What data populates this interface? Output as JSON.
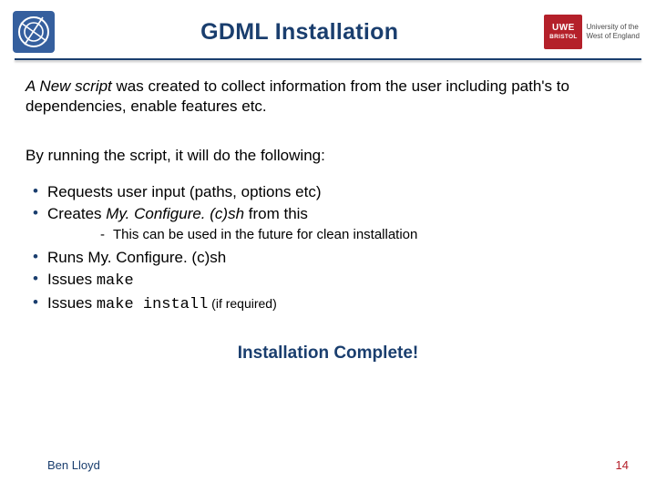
{
  "header": {
    "title": "GDML Installation",
    "cern_label": "CERN",
    "uwe": {
      "badge_top": "UWE",
      "badge_bottom": "BRISTOL",
      "line1": "University of the",
      "line2": "West of England"
    }
  },
  "intro": {
    "lead_ital": "A New script",
    "lead_rest": " was created to collect information from the user including path's to dependencies, enable features etc."
  },
  "lead2": "By running the script, it will do the following:",
  "bullets": {
    "b1": "Requests user input (paths, options etc)",
    "b2a": "Creates ",
    "b2b_ital": "My. Configure. (c)sh",
    "b2c": " from this",
    "b2_sub": "This can be used in the future for clean installation",
    "b3": "Runs My. Configure. (c)sh",
    "b4a": "Issues ",
    "b4b_mono": "make",
    "b5a": "Issues ",
    "b5b_mono": "make install",
    "b5c_small": " (if required)"
  },
  "complete": "Installation Complete!",
  "footer": {
    "author": "Ben Lloyd",
    "page": "14"
  }
}
